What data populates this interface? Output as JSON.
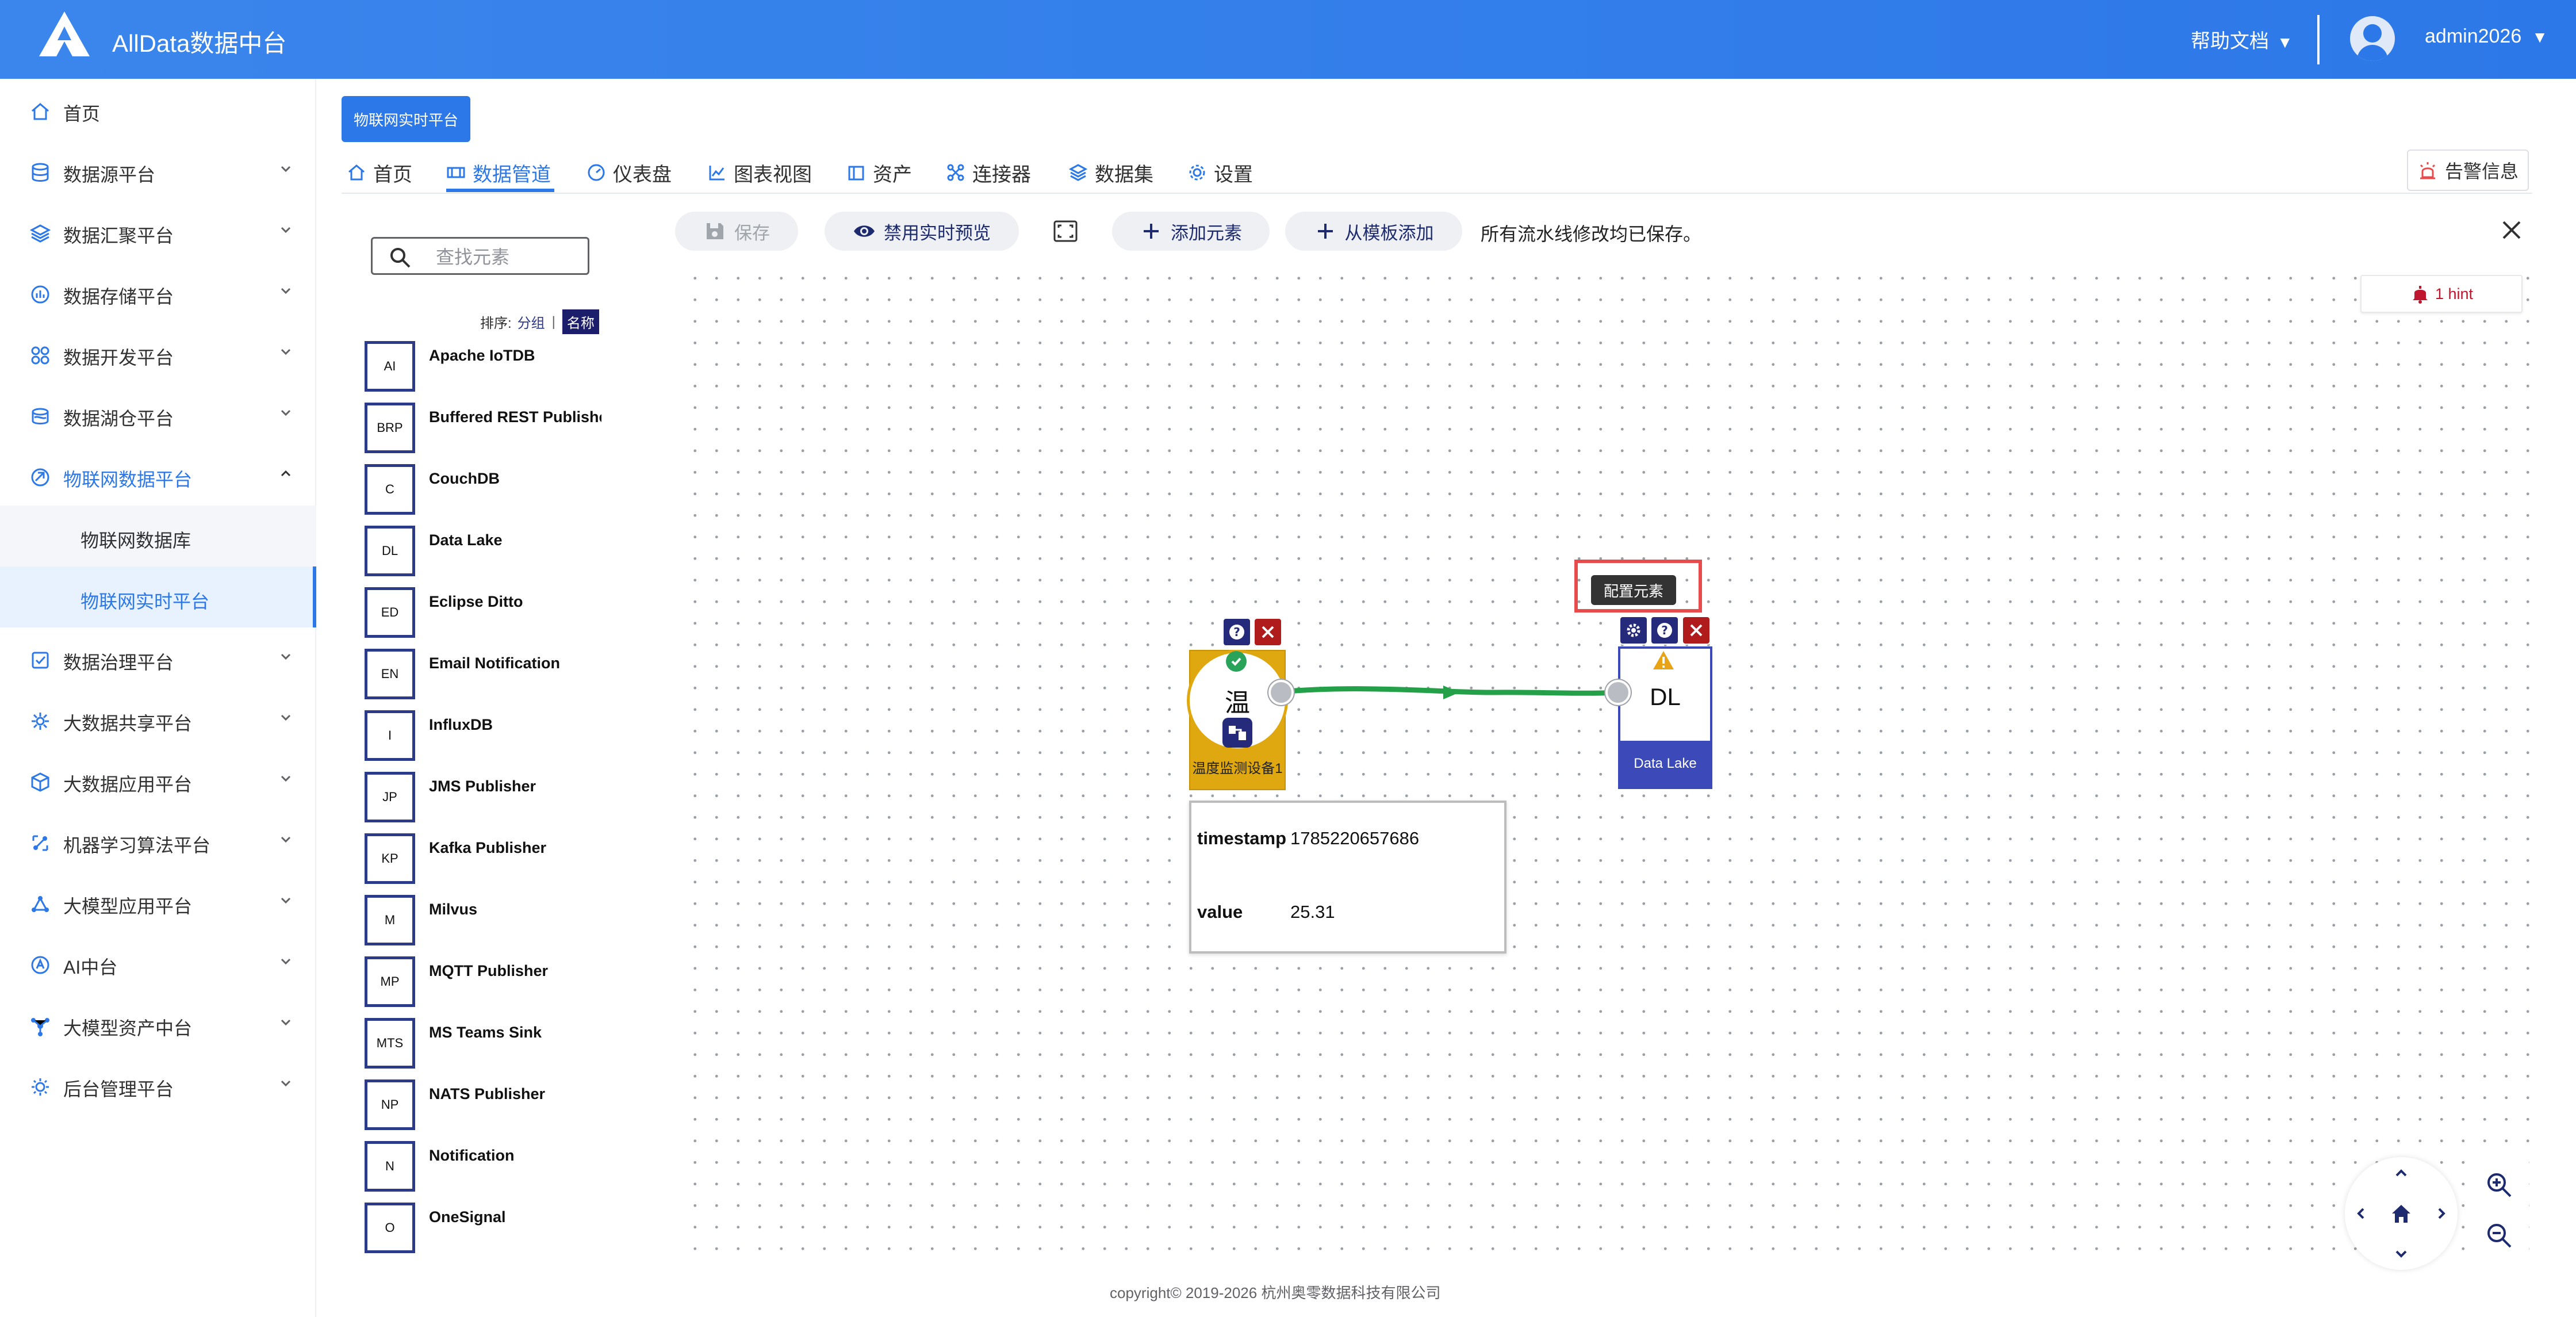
{
  "header": {
    "app_title": "AllData数据中台",
    "help_docs": "帮助文档",
    "user_name": "admin2026",
    "caret": "▼"
  },
  "sidebar": {
    "items": [
      {
        "label": "首页",
        "icon": "home-icon"
      },
      {
        "label": "数据源平台",
        "icon": "database-icon"
      },
      {
        "label": "数据汇聚平台",
        "icon": "layers-icon"
      },
      {
        "label": "数据存储平台",
        "icon": "storage-icon"
      },
      {
        "label": "数据开发平台",
        "icon": "grid-icon"
      },
      {
        "label": "数据湖仓平台",
        "icon": "lake-icon"
      },
      {
        "label": "物联网数据平台",
        "icon": "iot-icon"
      },
      {
        "label": "数据治理平台",
        "icon": "governance-icon"
      },
      {
        "label": "大数据共享平台",
        "icon": "share-icon"
      },
      {
        "label": "大数据应用平台",
        "icon": "cube-icon"
      },
      {
        "label": "机器学习算法平台",
        "icon": "ml-icon"
      },
      {
        "label": "大模型应用平台",
        "icon": "model-app-icon"
      },
      {
        "label": "AI中台",
        "icon": "ai-icon"
      },
      {
        "label": "大模型资产中台",
        "icon": "asset-icon"
      },
      {
        "label": "后台管理平台",
        "icon": "admin-icon"
      }
    ],
    "sub_items": [
      {
        "label": "物联网数据库"
      },
      {
        "label": "物联网实时平台"
      }
    ]
  },
  "page_tag": "物联网实时平台",
  "tabs": [
    {
      "label": "首页",
      "icon": "home-icon"
    },
    {
      "label": "数据管道",
      "icon": "pipeline-icon"
    },
    {
      "label": "仪表盘",
      "icon": "dashboard-icon"
    },
    {
      "label": "图表视图",
      "icon": "chart-icon"
    },
    {
      "label": "资产",
      "icon": "asset-icon"
    },
    {
      "label": "连接器",
      "icon": "connector-icon"
    },
    {
      "label": "数据集",
      "icon": "dataset-icon"
    },
    {
      "label": "设置",
      "icon": "settings-icon"
    }
  ],
  "alarm_button": "告警信息",
  "palette": {
    "search_placeholder": "查找元素",
    "sort_label": "排序:",
    "sort_group": "分组",
    "sort_separator": "|",
    "sort_name": "名称",
    "items": [
      {
        "abbr": "AI",
        "name": "Apache IoTDB"
      },
      {
        "abbr": "BRP",
        "name": "Buffered REST Publisher"
      },
      {
        "abbr": "C",
        "name": "CouchDB"
      },
      {
        "abbr": "DL",
        "name": "Data Lake"
      },
      {
        "abbr": "ED",
        "name": "Eclipse Ditto"
      },
      {
        "abbr": "EN",
        "name": "Email Notification"
      },
      {
        "abbr": "I",
        "name": "InfluxDB"
      },
      {
        "abbr": "JP",
        "name": "JMS Publisher"
      },
      {
        "abbr": "KP",
        "name": "Kafka Publisher"
      },
      {
        "abbr": "M",
        "name": "Milvus"
      },
      {
        "abbr": "MP",
        "name": "MQTT Publisher"
      },
      {
        "abbr": "MTS",
        "name": "MS Teams Sink"
      },
      {
        "abbr": "NP",
        "name": "NATS Publisher"
      },
      {
        "abbr": "N",
        "name": "Notification"
      },
      {
        "abbr": "O",
        "name": "OneSignal"
      }
    ]
  },
  "toolbar": {
    "save": "保存",
    "disable_preview": "禁用实时预览",
    "add_element": "添加元素",
    "add_from_template": "从模板添加",
    "status": "所有流水线修改均已保存。"
  },
  "hint": "1 hint",
  "pipeline": {
    "source": {
      "symbol": "温",
      "label": "温度监测设备1"
    },
    "sink": {
      "abbr": "DL",
      "label": "Data Lake"
    },
    "tooltip": "配置元素",
    "preview": [
      {
        "key": "timestamp",
        "value": "1785220657686"
      },
      {
        "key": "value",
        "value": "25.31"
      }
    ]
  },
  "footer": "copyright© 2019-2026 杭州奥零数据科技有限公司",
  "colors": {
    "header": "#2d78e8",
    "accent": "#2d78e8",
    "node_dark": "#262a7a",
    "source_node": "#e0a810",
    "sink_node": "#3b4ab8",
    "edge": "#24a148",
    "delete": "#b01b1b"
  }
}
